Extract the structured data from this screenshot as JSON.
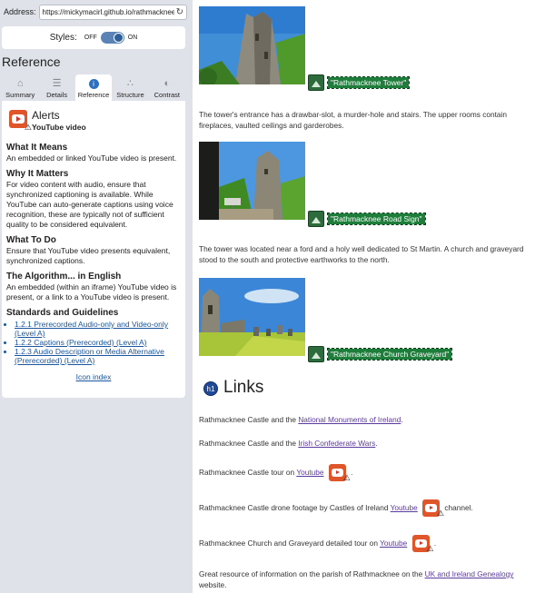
{
  "address": {
    "label": "Address:",
    "url": "https://mickymacirl.github.io/rathmacknee"
  },
  "styles": {
    "label": "Styles:",
    "off": "OFF",
    "on": "ON"
  },
  "reference_heading": "Reference",
  "tabs": [
    {
      "label": "Summary",
      "icon": "home-icon"
    },
    {
      "label": "Details",
      "icon": "list-icon"
    },
    {
      "label": "Reference",
      "icon": "info-icon"
    },
    {
      "label": "Structure",
      "icon": "structure-icon"
    },
    {
      "label": "Contrast",
      "icon": "contrast-icon"
    }
  ],
  "alert": {
    "title": "Alerts",
    "subtitle": "YouTube video",
    "what_heading": "What It Means",
    "what_text": "An embedded or linked YouTube video is present.",
    "why_heading": "Why It Matters",
    "why_text": "For video content with audio, ensure that synchronized captioning is available. While YouTube can auto-generate captions using voice recognition, these are typically not of sufficient quality to be considered equivalent.",
    "todo_heading": "What To Do",
    "todo_text": "Ensure that YouTube video presents equivalent, synchronized captions.",
    "algo_heading": "The Algorithm... in English",
    "algo_text": "An embedded (within an iframe) YouTube video is present, or a link to a YouTube video is present.",
    "standards_heading": "Standards and Guidelines",
    "standards": [
      "1.2.1 Prerecorded Audio-only and Video-only (Level A)",
      "1.2.2 Captions (Prerecorded) (Level A)",
      "1.2.3 Audio Description or Media Alternative (Prerecorded) (Level A)"
    ],
    "icon_index": "Icon index"
  },
  "content": {
    "img1_alt": "\"Rathmacknee Tower\"",
    "para1a": "The tower's entrance has a drawbar-slot, a murder-hole and stairs. The upper rooms contain",
    "para1b": "fireplaces, vaulted ceilings and garderobes.",
    "img2_alt": "\"Rathmacknee Road Sign\"",
    "para2a": "The tower was located near a ford and a holy well dedicated to St Martin. A church and graveyard",
    "para2b": "stood to the south and protective earthworks to the north.",
    "img3_alt": "\"Rathmacknee Church Graveyard\"",
    "h1_badge": "h1",
    "links_heading": "Links",
    "l1_pre": "Rathmacknee Castle and the ",
    "l1_link": "National Monuments of Ireland",
    "l1_post": ".",
    "l2_pre": "Rathmacknee Castle and the ",
    "l2_link": "Irish Confederate Wars",
    "l2_post": ".",
    "l3_pre": "Rathmacknee Castle tour on ",
    "l3_link": "Youtube",
    "l3_post": ".",
    "l4_pre": "Rathmacknee Castle drone footage by Castles of Ireland ",
    "l4_link": "Youtube",
    "l4_post": "channel.",
    "l5_pre": "Rathmacknee Church and Graveyard detailed tour on ",
    "l5_link": "Youtube",
    "l5_post": ".",
    "l6_pre": "Great resource of information on the parish of Rathmacknee on the ",
    "l6_link": "UK and Ireland Genealogy",
    "l6_post": "website."
  }
}
